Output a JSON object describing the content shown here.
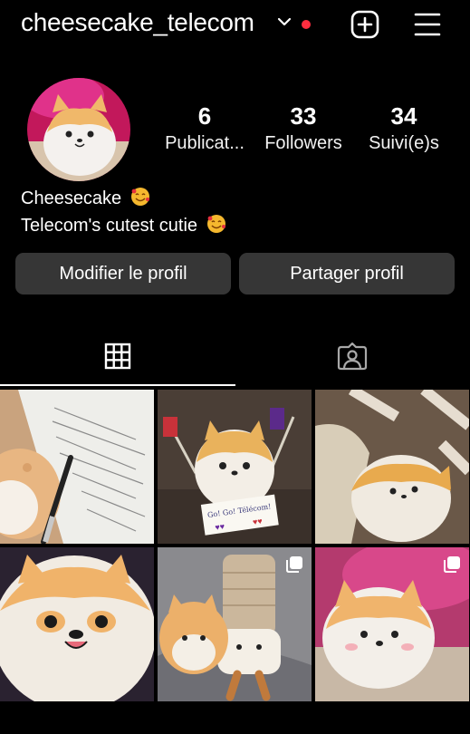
{
  "header": {
    "username": "cheesecake_telecom",
    "dropdown_icon": "chevron-down-icon",
    "notification_dot_color": "#ff2d3f",
    "create_icon": "plus-square-icon",
    "menu_icon": "hamburger-menu-icon"
  },
  "profile": {
    "stats": [
      {
        "value": "6",
        "label": "Publicat..."
      },
      {
        "value": "33",
        "label": "Followers"
      },
      {
        "value": "34",
        "label": "Suivi(e)s"
      }
    ],
    "bio_name": "Cheesecake",
    "bio_text": "Telecom's cutest cutie",
    "bio_emoji": "smiling-face-with-hearts"
  },
  "actions": {
    "edit_label": "Modifier le profil",
    "share_label": "Partager profil"
  },
  "tabs": [
    {
      "icon": "grid-icon",
      "active": true
    },
    {
      "icon": "tagged-person-icon",
      "active": false
    }
  ],
  "posts": [
    {
      "subject": "plush on exam paper with pen",
      "multi": false
    },
    {
      "subject": "plush holding Go! Go! Telecom! sign",
      "multi": false,
      "sign_text": "Go! Go! Télécom!"
    },
    {
      "subject": "plush on striped blanket",
      "multi": false
    },
    {
      "subject": "plush face close-up",
      "multi": false
    },
    {
      "subject": "plush with crochet character",
      "multi": true
    },
    {
      "subject": "plush on pink blanket",
      "multi": true
    }
  ]
}
